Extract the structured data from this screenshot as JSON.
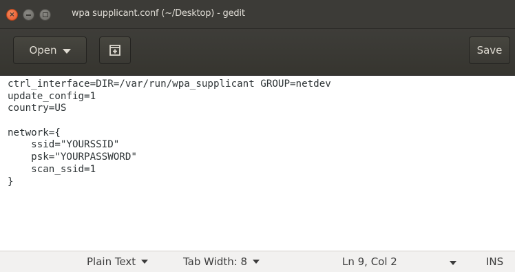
{
  "window": {
    "title": "wpa supplicant.conf (~/Desktop) - gedit"
  },
  "header": {
    "open_label": "Open",
    "save_label": "Save"
  },
  "editor": {
    "lines": [
      "ctrl_interface=DIR=/var/run/wpa_supplicant GROUP=netdev",
      "update_config=1",
      "country=US",
      "",
      "network={",
      "    ssid=\"YOURSSID\"",
      "    psk=\"YOURPASSWORD\"",
      "    scan_ssid=1",
      "}"
    ]
  },
  "statusbar": {
    "language": "Plain Text",
    "tab_width": "Tab Width: 8",
    "cursor_position": "Ln 9, Col 2",
    "insert_mode": "INS"
  },
  "icons": {
    "close": "close-icon",
    "minimize": "minimize-icon",
    "maximize": "maximize-icon",
    "new_tab": "new-document-icon",
    "dropdown": "chevron-down-icon"
  },
  "colors": {
    "titlebar_bg": "#3c3b37",
    "close_button": "#e4532a",
    "editor_bg": "#ffffff",
    "statusbar_bg": "#f2f1f0"
  }
}
